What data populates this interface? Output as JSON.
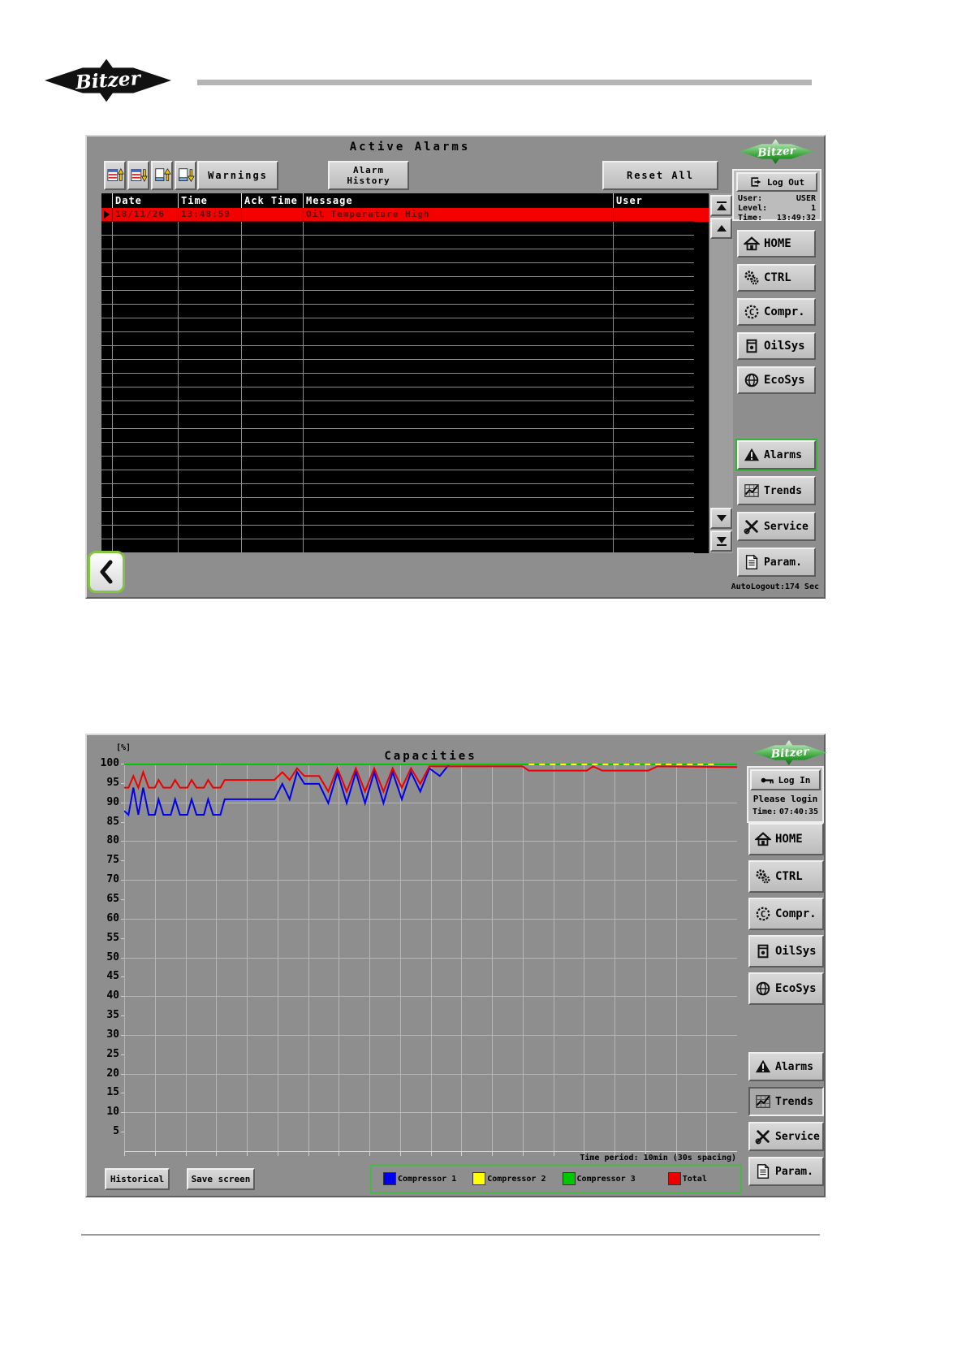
{
  "brand": "Bitzer",
  "nav_labels": {
    "home": "HOME",
    "ctrl": "CTRL",
    "compr": "Compr.",
    "oilsys": "OilSys",
    "ecosys": "EcoSys",
    "alarms": "Alarms",
    "trends": "Trends",
    "service": "Service",
    "param": "Param."
  },
  "alarm_screen": {
    "title": "Active Alarms",
    "warnings_button": "Warnings",
    "alarm_history_button": "Alarm History",
    "reset_all_button": "Reset All",
    "table": {
      "columns": {
        "date": "Date",
        "time": "Time",
        "ack_time": "Ack Time",
        "message": "Message",
        "user": "User"
      },
      "alarm_row": {
        "date": "18/11/26",
        "time": "13:48:59",
        "ack_time": "",
        "message": "Oil Temperature High",
        "user": ""
      },
      "empty_rows": 24
    },
    "session": {
      "logout_button": "Log Out",
      "user_label": "User:",
      "user_value": "USER",
      "level_label": "Level:",
      "level_value": "1",
      "time_label": "Time:",
      "time_value": "13:49:32"
    },
    "autologout": "AutoLogout:174 Sec"
  },
  "trend_screen": {
    "title": "Capacities",
    "unit_label": "[%]",
    "historical_button": "Historical",
    "save_screen_button": "Save screen",
    "time_period": "Time period: 10min (30s spacing)",
    "session": {
      "login_button": "Log In",
      "message": "Please login",
      "time_label": "Time:",
      "time_value": "07:40:35"
    }
  },
  "chart_data": {
    "type": "line",
    "title": "Capacities",
    "ylabel": "[%]",
    "ylim": [
      0,
      100
    ],
    "yticks": [
      100,
      95,
      90,
      85,
      80,
      75,
      70,
      65,
      60,
      55,
      50,
      45,
      40,
      35,
      30,
      25,
      20,
      15,
      10,
      5
    ],
    "x_divisions": 20,
    "time_period": "10min (30s spacing)",
    "grid": true,
    "legend_position": "bottom",
    "series": [
      {
        "name": "Compressor 1",
        "color": "#0000ee",
        "points": [
          [
            0,
            88
          ],
          [
            0.7,
            87
          ],
          [
            1.5,
            94
          ],
          [
            2.3,
            87
          ],
          [
            3.1,
            94
          ],
          [
            4,
            87
          ],
          [
            5,
            87
          ],
          [
            5.6,
            91
          ],
          [
            6.4,
            87
          ],
          [
            7.6,
            87
          ],
          [
            8.3,
            91
          ],
          [
            9.1,
            87
          ],
          [
            10.3,
            87
          ],
          [
            11,
            91
          ],
          [
            11.8,
            87
          ],
          [
            13,
            87
          ],
          [
            13.7,
            91
          ],
          [
            14.5,
            87
          ],
          [
            15.7,
            87
          ],
          [
            16.4,
            91
          ],
          [
            17.2,
            91
          ],
          [
            24.5,
            91
          ],
          [
            25.8,
            95
          ],
          [
            27,
            91
          ],
          [
            28.2,
            98
          ],
          [
            29.4,
            95
          ],
          [
            31.8,
            95
          ],
          [
            33.3,
            90
          ],
          [
            34.8,
            98
          ],
          [
            36.3,
            90
          ],
          [
            37.8,
            98
          ],
          [
            39.3,
            90
          ],
          [
            40.8,
            98
          ],
          [
            42.3,
            90
          ],
          [
            43.8,
            98
          ],
          [
            45.3,
            91
          ],
          [
            46.8,
            98
          ],
          [
            48.3,
            93
          ],
          [
            49.8,
            99
          ],
          [
            51.5,
            97
          ],
          [
            53,
            100
          ],
          [
            100,
            100
          ]
        ]
      },
      {
        "name": "Compressor 2",
        "color": "#ffff00",
        "dashed": true,
        "points": [
          [
            66,
            100
          ],
          [
            97,
            100
          ]
        ]
      },
      {
        "name": "Compressor 3",
        "color": "#00c800",
        "points": [
          [
            0,
            100
          ],
          [
            100,
            100
          ]
        ]
      },
      {
        "name": "Total",
        "color": "#ee0000",
        "points": [
          [
            0,
            94
          ],
          [
            0.7,
            94
          ],
          [
            1.5,
            97
          ],
          [
            2.3,
            94
          ],
          [
            3.1,
            98
          ],
          [
            4,
            94
          ],
          [
            5,
            94
          ],
          [
            5.6,
            96
          ],
          [
            6.4,
            94
          ],
          [
            7.6,
            94
          ],
          [
            8.3,
            96
          ],
          [
            9.1,
            94
          ],
          [
            10.3,
            94
          ],
          [
            11,
            96
          ],
          [
            11.8,
            94
          ],
          [
            13,
            94
          ],
          [
            13.7,
            96
          ],
          [
            14.5,
            94
          ],
          [
            15.7,
            94
          ],
          [
            16.4,
            96
          ],
          [
            17.2,
            96
          ],
          [
            24.5,
            96
          ],
          [
            25.8,
            98
          ],
          [
            27,
            96
          ],
          [
            28.2,
            99
          ],
          [
            29.4,
            97
          ],
          [
            31.8,
            97
          ],
          [
            33.3,
            93
          ],
          [
            34.8,
            99
          ],
          [
            36.3,
            93
          ],
          [
            37.8,
            99
          ],
          [
            39.3,
            93
          ],
          [
            40.8,
            99
          ],
          [
            42.3,
            93
          ],
          [
            43.8,
            99
          ],
          [
            45.3,
            94
          ],
          [
            46.8,
            99
          ],
          [
            48.3,
            95
          ],
          [
            49.8,
            99.5
          ],
          [
            55,
            99.5
          ],
          [
            65,
            99.5
          ],
          [
            66,
            98.4
          ],
          [
            75.5,
            98.4
          ],
          [
            76.5,
            99.5
          ],
          [
            78,
            98.4
          ],
          [
            85.5,
            98.4
          ],
          [
            87,
            99.5
          ],
          [
            100,
            99.3
          ]
        ]
      }
    ]
  }
}
